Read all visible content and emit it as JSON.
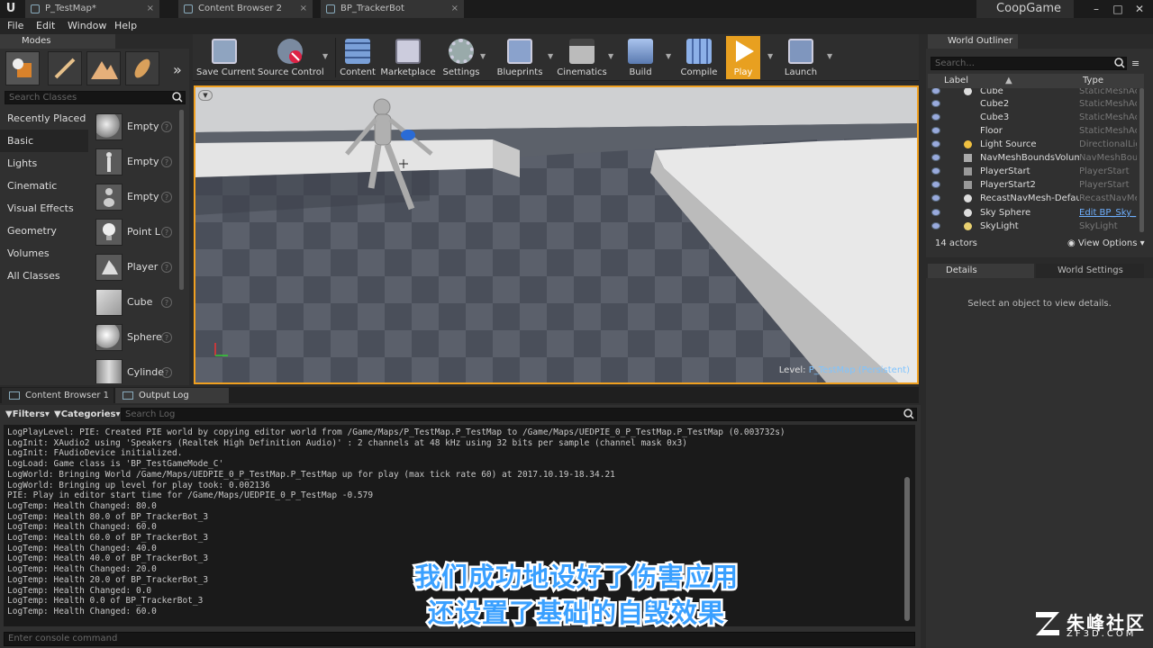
{
  "tabs": [
    {
      "label": "P_TestMap*"
    },
    {
      "label": "Content Browser 2"
    },
    {
      "label": "BP_TrackerBot"
    }
  ],
  "game_name": "CoopGame",
  "menu": [
    "File",
    "Edit",
    "Window",
    "Help"
  ],
  "modes": {
    "title": "Modes",
    "search_placeholder": "Search Classes",
    "categories": [
      "Recently Placed",
      "Basic",
      "Lights",
      "Cinematic",
      "Visual Effects",
      "Geometry",
      "Volumes",
      "All Classes"
    ],
    "items": [
      "Empty",
      "Empty",
      "Empty",
      "Point L",
      "Player",
      "Cube",
      "Sphere",
      "Cylinde"
    ]
  },
  "toolbar": [
    "Save Current",
    "Source Control",
    "Content",
    "Marketplace",
    "Settings",
    "Blueprints",
    "Cinematics",
    "Build",
    "Compile",
    "Play",
    "Launch"
  ],
  "viewport": {
    "level_prefix": "Level:",
    "level_name": "P_TestMap (Persistent)"
  },
  "outliner": {
    "title": "World Outliner",
    "search_placeholder": "Search...",
    "col_label": "Label",
    "col_type": "Type",
    "rows": [
      {
        "label": "Cube",
        "type": "StaticMeshAc"
      },
      {
        "label": "Cube2",
        "type": "StaticMeshAc"
      },
      {
        "label": "Cube3",
        "type": "StaticMeshAc"
      },
      {
        "label": "Floor",
        "type": "StaticMeshAc"
      },
      {
        "label": "Light Source",
        "type": "DirectionalLig"
      },
      {
        "label": "NavMeshBoundsVolume",
        "type": "NavMeshBou"
      },
      {
        "label": "PlayerStart",
        "type": "PlayerStart"
      },
      {
        "label": "PlayerStart2",
        "type": "PlayerStart"
      },
      {
        "label": "RecastNavMesh-Default",
        "type": "RecastNavMe"
      },
      {
        "label": "Sky Sphere",
        "type": "Edit BP_Sky_"
      },
      {
        "label": "SkyLight",
        "type": "SkyLight"
      }
    ],
    "actor_count": "14 actors",
    "view_options": "View Options"
  },
  "details": {
    "tab": "Details",
    "world_settings_tab": "World Settings",
    "empty_msg": "Select an object to view details."
  },
  "bottom": {
    "tab1": "Content Browser 1",
    "tab2": "Output Log",
    "filters": "Filters",
    "categories": "Categories",
    "search_placeholder": "Search Log",
    "console_placeholder": "Enter console command",
    "log": [
      "LogPlayLevel: PIE: Created PIE world by copying editor world from /Game/Maps/P_TestMap.P_TestMap to /Game/Maps/UEDPIE_0_P_TestMap.P_TestMap (0.003732s)",
      "LogInit: XAudio2 using 'Speakers (Realtek High Definition Audio)' : 2 channels at 48 kHz using 32 bits per sample (channel mask 0x3)",
      "LogInit: FAudioDevice initialized.",
      "LogLoad: Game class is 'BP_TestGameMode_C'",
      "LogWorld: Bringing World /Game/Maps/UEDPIE_0_P_TestMap.P_TestMap up for play (max tick rate 60) at 2017.10.19-18.34.21",
      "LogWorld: Bringing up level for play took: 0.002136",
      "PIE: Play in editor start time for /Game/Maps/UEDPIE_0_P_TestMap -0.579",
      "LogTemp: Health Changed: 80.0",
      "LogTemp: Health 80.0 of BP_TrackerBot_3",
      "LogTemp: Health Changed: 60.0",
      "LogTemp: Health 60.0 of BP_TrackerBot_3",
      "LogTemp: Health Changed: 40.0",
      "LogTemp: Health 40.0 of BP_TrackerBot_3",
      "LogTemp: Health Changed: 20.0",
      "LogTemp: Health 20.0 of BP_TrackerBot_3",
      "LogTemp: Health Changed: 0.0",
      "LogTemp: Health 0.0 of BP_TrackerBot_3",
      "LogTemp: Health Changed: 60.0"
    ]
  },
  "subtitles": [
    "我们成功地设好了伤害应用",
    "还设置了基础的自毁效果"
  ],
  "watermark": {
    "name": "朱峰社区",
    "url": "ZF3D.COM"
  },
  "colors": {
    "play": "#e8a020",
    "accent": "#3aa0ff"
  }
}
